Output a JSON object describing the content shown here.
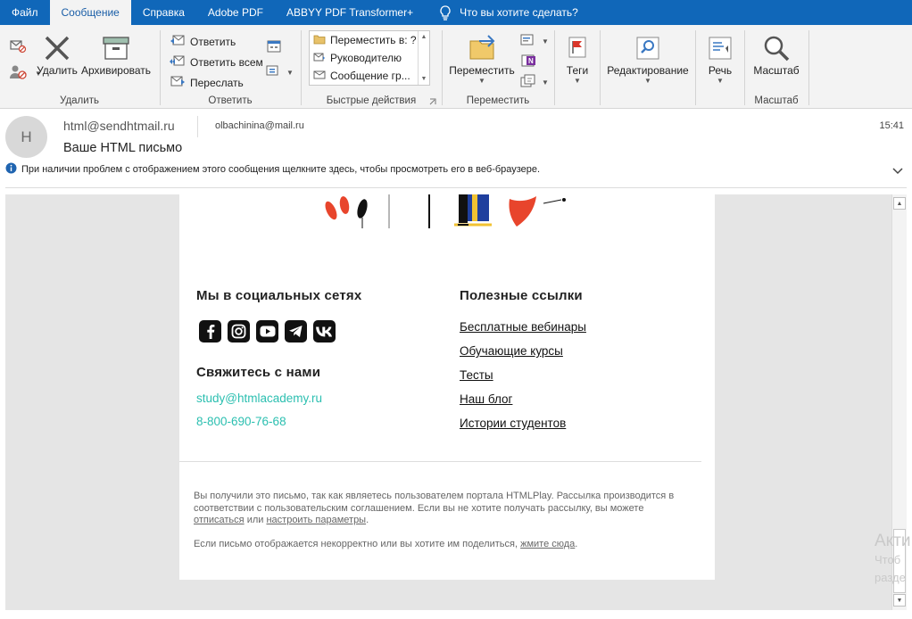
{
  "menu": {
    "tabs": [
      "Файл",
      "Сообщение",
      "Справка",
      "Adobe PDF",
      "ABBYY PDF Transformer+"
    ],
    "active_tab": "Сообщение",
    "tell_me": "Что вы хотите сделать?"
  },
  "ribbon": {
    "delete_group": {
      "label": "Удалить",
      "delete": "Удалить",
      "archive": "Архивировать"
    },
    "respond_group": {
      "label": "Ответить",
      "reply": "Ответить",
      "reply_all": "Ответить всем",
      "forward": "Переслать"
    },
    "quick_steps": {
      "label": "Быстрые действия",
      "items": [
        "Переместить в: ?",
        "Руководителю",
        "Сообщение гр..."
      ]
    },
    "move_group": {
      "label": "Переместить",
      "move": "Переместить"
    },
    "tags": {
      "label": "Теги"
    },
    "editing": {
      "label": "Редактирование"
    },
    "speech": {
      "label": "Речь"
    },
    "zoom_group": {
      "label": "Масштаб",
      "zoom": "Масштаб"
    }
  },
  "message": {
    "avatar_initial": "H",
    "sender": "html@sendhtmail.ru",
    "recipient": "olbachinina@mail.ru",
    "subject": "Ваше HTML письмо",
    "time": "15:41",
    "info": "При наличии проблем с отображением этого сообщения щелкните здесь, чтобы просмотреть его в веб-браузере."
  },
  "email": {
    "social_title": "Мы в социальных сетях",
    "social_icons": [
      "facebook-icon",
      "instagram-icon",
      "youtube-icon",
      "telegram-icon",
      "vk-icon"
    ],
    "contact_title": "Свяжитесь с нами",
    "email": "study@htmlacademy.ru",
    "phone": "8-800-690-76-68",
    "links_title": "Полезные ссылки",
    "links": [
      "Бесплатные вебинары",
      "Обучающие курсы",
      "Тесты",
      "Наш блог",
      "Истории студентов"
    ],
    "footer": {
      "line1": "Вы получили это письмо, так как являетесь пользователем портала HTMLPlay. Рассылка производится в соответствии с пользовательским соглашением. Если вы не хотите получать рассылку, вы можете",
      "unsubscribe": "отписаться",
      "or": "или",
      "settings": "настроить параметры",
      "line2_pre": "Если письмо отображается некорректно или вы хотите им поделиться,",
      "click_here": "жмите сюда"
    },
    "accent_color": "#2bbfb0"
  },
  "watermark": {
    "line1": "Акти",
    "line2": "Чтоб",
    "line3": "разде"
  }
}
